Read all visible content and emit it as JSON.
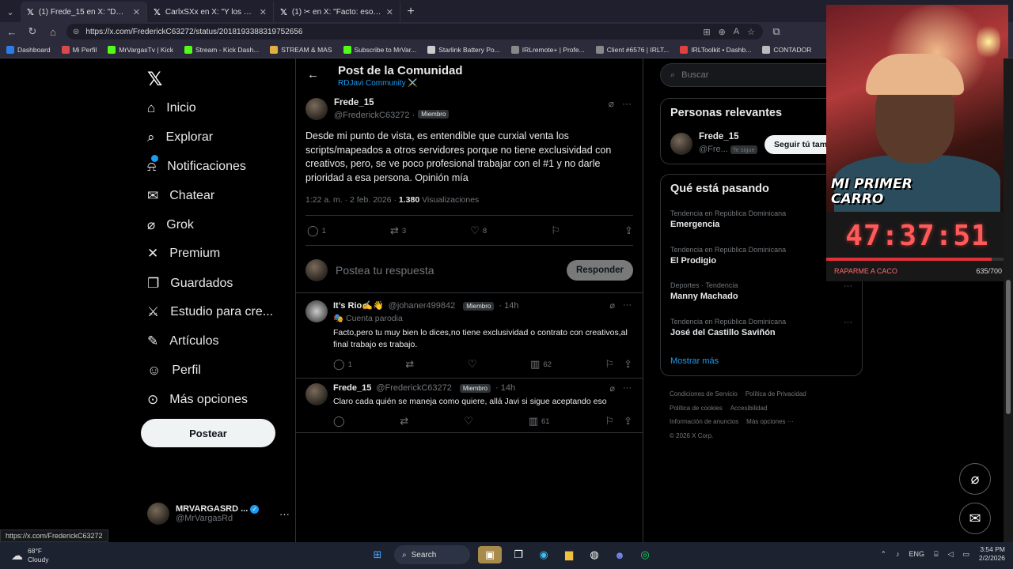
{
  "browser": {
    "tabs": [
      {
        "label": "(1) Frede_15 en X: \"Desde mi punto",
        "active": true
      },
      {
        "label": "CarlxSXx en X: \"Y los scrip no salen",
        "active": false
      },
      {
        "label": "(1) ✂ en X: \"Facto: esos scripts o",
        "active": false
      }
    ],
    "url": "https://x.com/FrederickC63272/status/2018193388319752656",
    "bookmarks": [
      {
        "label": "Dashboard",
        "color": "#2b7de9"
      },
      {
        "label": "Mi Perfil",
        "color": "#d94a4a"
      },
      {
        "label": "MrVargasTv | Kick",
        "color": "#53fc18"
      },
      {
        "label": "Stream - Kick Dash...",
        "color": "#53fc18"
      },
      {
        "label": "STREAM & MAS",
        "color": "#e0b040"
      },
      {
        "label": "Subscribe to MrVar...",
        "color": "#53fc18"
      },
      {
        "label": "Starlink Battery Po...",
        "color": "#cccccc"
      },
      {
        "label": "IRLremote+ | Profe...",
        "color": "#888888"
      },
      {
        "label": "Client #6576 | IRLT...",
        "color": "#888888"
      },
      {
        "label": "IRLToolkit • Dashb...",
        "color": "#e04040"
      },
      {
        "label": "CONTADOR",
        "color": "#bbbbbb"
      }
    ]
  },
  "nav": {
    "items": [
      {
        "label": "Inicio",
        "icon": "⌂"
      },
      {
        "label": "Explorar",
        "icon": "⌕"
      },
      {
        "label": "Notificaciones",
        "icon": "⍾"
      },
      {
        "label": "Chatear",
        "icon": "✉"
      },
      {
        "label": "Grok",
        "icon": "⌀"
      },
      {
        "label": "Premium",
        "icon": "✕"
      },
      {
        "label": "Guardados",
        "icon": "❐"
      },
      {
        "label": "Estudio para cre...",
        "icon": "⚔"
      },
      {
        "label": "Artículos",
        "icon": "✎"
      },
      {
        "label": "Perfil",
        "icon": "☺"
      },
      {
        "label": "Más opciones",
        "icon": "⊙"
      }
    ],
    "post_button": "Postear",
    "account": {
      "name": "MRVARGASRD ...",
      "handle": "@MrVargasRd"
    }
  },
  "header": {
    "title": "Post de la Comunidad",
    "community": "RDJavi Community ⚔️"
  },
  "post": {
    "name": "Frede_15",
    "handle": "@FrederickC63272",
    "badge": "Miembro",
    "text": "Desde mi punto de vista, es entendible que curxial venta los scripts/mapeados a otros servidores porque no tiene exclusividad con creativos, pero, se ve poco profesional trabajar con el #1 y no darle prioridad a esa persona. Opinión mía",
    "time": "1:22 a. m. · 2 feb. 2026 ·",
    "views": "1.380",
    "views_label": "Visualizaciones",
    "replies": "1",
    "reposts": "3",
    "likes": "8"
  },
  "reply_box": {
    "placeholder": "Postea tu respuesta",
    "button": "Responder"
  },
  "replies": [
    {
      "name": "It’s Rio✍️👋",
      "handle": "@johaner499842",
      "badge": "Miembro",
      "time": "· 14h",
      "note": "🎭 Cuenta parodia",
      "text": "Facto,pero tu muy bien lo dices,no tiene exclusividad o contrato con creativos,al final trabajo es trabajo.",
      "replies": "1",
      "reposts": "",
      "likes": "",
      "views": "62"
    },
    {
      "name": "Frede_15",
      "handle": "@FrederickC63272",
      "badge": "Miembro",
      "time": "· 14h",
      "note": "",
      "text": "Claro cada quién se maneja como quiere, allá Javi si sigue aceptando eso",
      "replies": "",
      "reposts": "",
      "likes": "",
      "views": "61"
    }
  ],
  "sidebar": {
    "search_placeholder": "Buscar",
    "relevant_title": "Personas relevantes",
    "relevant_user": {
      "name": "Frede_15",
      "handle": "@Fre...",
      "follows_you": "Te sigue",
      "follow_label": "Seguir tú tam"
    },
    "trending_title": "Qué está pasando",
    "trends": [
      {
        "context": "Tendencia en República Dominicana",
        "name": "Emergencia"
      },
      {
        "context": "Tendencia en República Dominicana",
        "name": "El Prodigio"
      },
      {
        "context": "Deportes · Tendencia",
        "name": "Manny Machado"
      },
      {
        "context": "Tendencia en República Dominicana",
        "name": "José del Castillo Saviñón"
      }
    ],
    "show_more": "Mostrar más",
    "footer": [
      "Condiciones de Servicio",
      "Política de Privacidad",
      "Política de cookies",
      "Accesibilidad",
      "Información de anuncios",
      "Más opciones ···",
      "© 2026 X Corp."
    ]
  },
  "overlay": {
    "banner": "MI PRIMER CARRO",
    "timer": "47:37:51",
    "goal_label": "RAPARME A CACO",
    "goal_count": "635/700",
    "goal_progress": 0.907
  },
  "status_url": "https://x.com/FrederickC63272",
  "taskbar": {
    "temp": "68°F",
    "weather": "Cloudy",
    "search": "Search",
    "lang": "ENG",
    "time": "3:54 PM",
    "date": "2/2/2026"
  }
}
